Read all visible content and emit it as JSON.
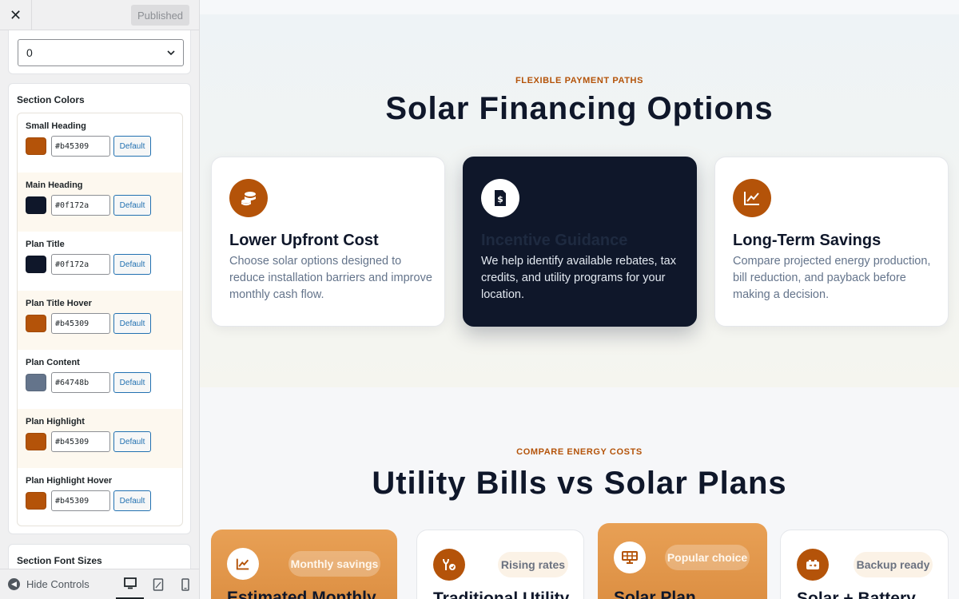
{
  "header": {
    "publish_label": "Published"
  },
  "top_control": {
    "select_value": "0"
  },
  "section_colors": {
    "title": "Section Colors",
    "items": [
      {
        "label": "Small Heading",
        "hex": "#b45309",
        "color": "#b45309",
        "default_label": "Default"
      },
      {
        "label": "Main Heading",
        "hex": "#0f172a",
        "color": "#0f172a",
        "default_label": "Default"
      },
      {
        "label": "Plan Title",
        "hex": "#0f172a",
        "color": "#0f172a",
        "default_label": "Default"
      },
      {
        "label": "Plan Title Hover",
        "hex": "#b45309",
        "color": "#b45309",
        "default_label": "Default"
      },
      {
        "label": "Plan Content",
        "hex": "#64748b",
        "color": "#64748b",
        "default_label": "Default"
      },
      {
        "label": "Plan Highlight",
        "hex": "#b45309",
        "color": "#b45309",
        "default_label": "Default"
      },
      {
        "label": "Plan Highlight Hover",
        "hex": "#b45309",
        "color": "#b45309",
        "default_label": "Default"
      }
    ]
  },
  "section_font_sizes": {
    "title": "Section Font Sizes"
  },
  "footer": {
    "hide_controls_label": "Hide Controls"
  },
  "financing": {
    "eyebrow": "FLEXIBLE PAYMENT PATHS",
    "heading": "Solar Financing Options",
    "cards": [
      {
        "icon": "coins-icon",
        "title": "Lower Upfront Cost",
        "desc": "Choose solar options designed to reduce installation barriers and improve monthly cash flow."
      },
      {
        "icon": "dollar-document-icon",
        "title": "Incentive Guidance",
        "desc": "We help identify available rebates, tax credits, and utility programs for your location."
      },
      {
        "icon": "trend-chart-icon",
        "title": "Long-Term Savings",
        "desc": "Compare projected energy production, bill reduction, and payback before making a decision."
      }
    ]
  },
  "compare": {
    "eyebrow": "COMPARE ENERGY COSTS",
    "heading": "Utility Bills vs Solar Plans",
    "plans": [
      {
        "icon": "trend-chart-icon",
        "badge": "Monthly savings",
        "title": "Estimated Monthly"
      },
      {
        "icon": "rising-rates-icon",
        "badge": "Rising rates",
        "title": "Traditional Utility"
      },
      {
        "icon": "solar-panel-icon",
        "badge": "Popular choice",
        "title": "Solar Plan"
      },
      {
        "icon": "battery-icon",
        "badge": "Backup ready",
        "title": "Solar + Battery"
      }
    ]
  },
  "colors": {
    "accent": "#b45309",
    "dark": "#0f172a",
    "muted": "#64748b",
    "wp_blue": "#2271b1"
  }
}
